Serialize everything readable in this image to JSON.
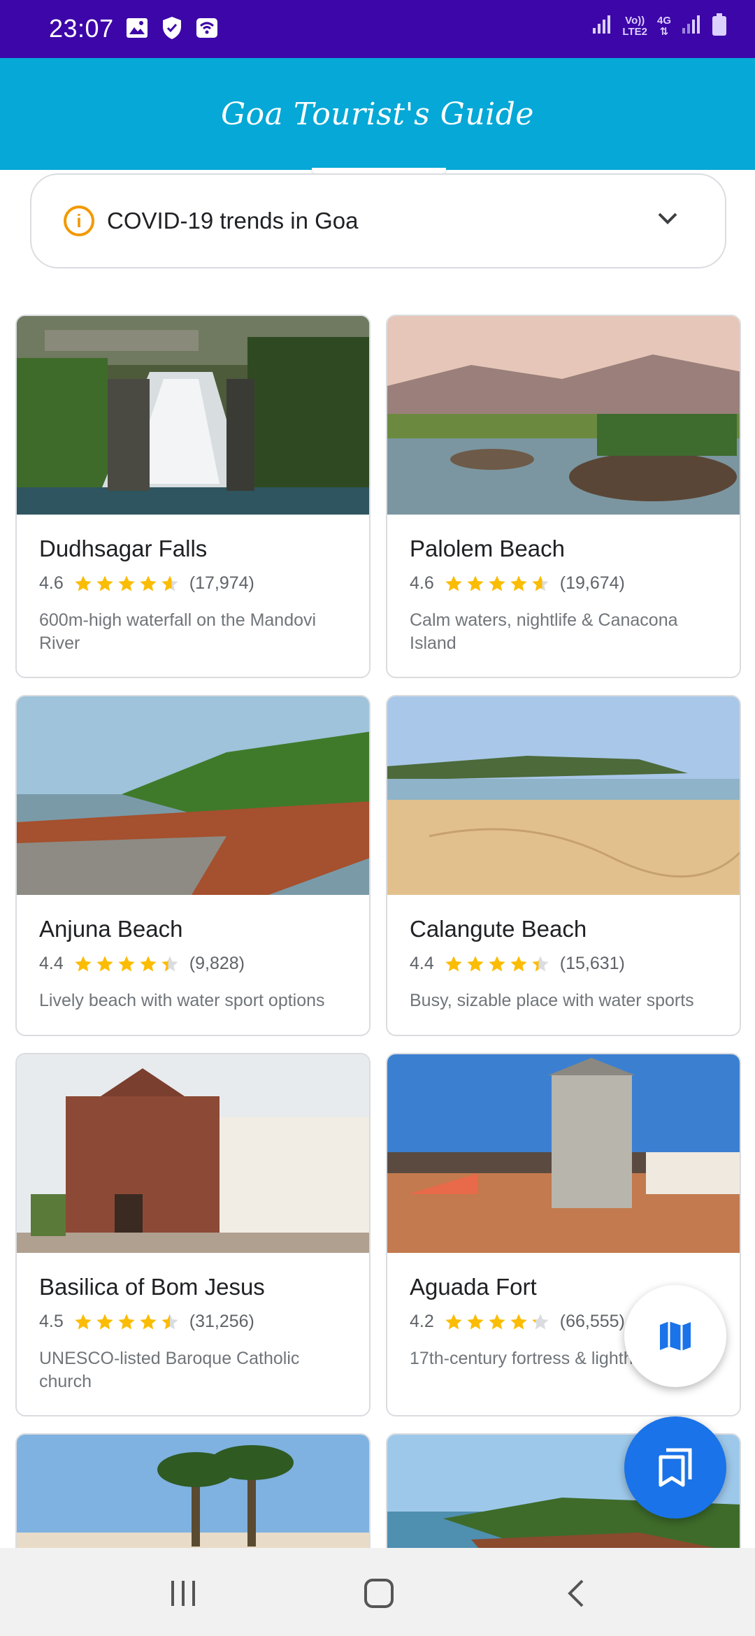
{
  "status_bar": {
    "time": "23:07",
    "icons_left": [
      "image-icon",
      "shield-check-icon",
      "wifi-calling-icon"
    ],
    "network_label_1": "Vo))",
    "network_label_2": "LTE2",
    "network_label_3": "4G",
    "icons_right": [
      "signal-icon",
      "signal-icon",
      "battery-icon"
    ]
  },
  "app_bar": {
    "title": "Goa Tourist's Guide"
  },
  "covid_banner": {
    "label": "COVID-19 trends in Goa",
    "icon": "info-icon",
    "chevron": "chevron-down-icon"
  },
  "places": [
    {
      "name": "Dudhsagar Falls",
      "rating": "4.6",
      "stars": 4.6,
      "reviews": "(17,974)",
      "description": "600m-high waterfall on the Mandovi River",
      "photo": "waterfall"
    },
    {
      "name": "Palolem Beach",
      "rating": "4.6",
      "stars": 4.6,
      "reviews": "(19,674)",
      "description": "Calm waters, nightlife & Canacona Island",
      "photo": "beach-rocks"
    },
    {
      "name": "Anjuna Beach",
      "rating": "4.4",
      "stars": 4.4,
      "reviews": "(9,828)",
      "description": "Lively beach with water sport options",
      "photo": "coast-cliff"
    },
    {
      "name": "Calangute Beach",
      "rating": "4.4",
      "stars": 4.4,
      "reviews": "(15,631)",
      "description": "Busy, sizable place with water sports",
      "photo": "sand-beach"
    },
    {
      "name": "Basilica of Bom Jesus",
      "rating": "4.5",
      "stars": 4.5,
      "reviews": "(31,256)",
      "description": "UNESCO-listed Baroque Catholic church",
      "photo": "church"
    },
    {
      "name": "Aguada Fort",
      "rating": "4.2",
      "stars": 4.2,
      "reviews": "(66,555)",
      "description": "17th-century fortress & lighthouse",
      "photo": "fort"
    },
    {
      "name": "",
      "rating": "",
      "stars": 0,
      "reviews": "",
      "description": "",
      "photo": "palm-beach"
    },
    {
      "name": "",
      "rating": "",
      "stars": 0,
      "reviews": "",
      "description": "",
      "photo": "bay"
    }
  ],
  "fabs": {
    "map": "map-icon",
    "saved": "bookmarks-icon"
  },
  "nav_bar": {
    "recents": "recents-icon",
    "home": "home-icon",
    "back": "back-icon"
  },
  "colors": {
    "status_bar": "#3c06a8",
    "app_bar": "#05a8d6",
    "star": "#fbbc04",
    "fab_blue": "#1a73e8"
  }
}
